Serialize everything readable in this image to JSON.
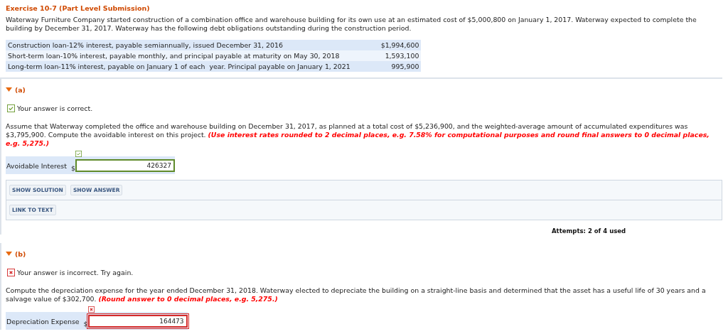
{
  "exercise": {
    "title": "Exercise 10-7 (Part Level Submission)",
    "intro": "Waterway Furniture Company started construction of a combination office and warehouse building for its own use at an estimated cost of $5,000,800 on January 1, 2017. Waterway expected to complete the building by December 31, 2017. Waterway has the following debt obligations outstanding during the construction period.",
    "loans": [
      {
        "description": "Construction loan-12% interest, payable semiannually, issued December 31, 2016",
        "amount": "$1,994,600"
      },
      {
        "description": "Short-term loan-10% interest, payable monthly, and principal payable at maturity on May 30, 2018",
        "amount": "1,593,100"
      },
      {
        "description": "Long-term loan-11% interest, payable on January 1 of each  year. Principal payable on January 1, 2021",
        "amount": "995,900"
      }
    ]
  },
  "parts": [
    {
      "label": "(a)",
      "expanded": true,
      "correct": true,
      "result": "Your answer is correct.",
      "question": "Assume that Waterway completed the office and warehouse building on December 31, 2017, as planned at a total cost of $5,236,900, and the weighted-average amount of accumulated expenditures was $3,795,900. Compute the avoidable interest on this project.",
      "instruction": "(Use interest rates rounded to 2 decimal places, e.g. 7.58% for computational purposes and round final answers to 0 decimal places, e.g. 5,275.)",
      "answer": {
        "label": "Avoidable Interest",
        "unit": "$",
        "value": "426327"
      },
      "buttons": [
        "SHOW SOLUTION",
        "SHOW ANSWER"
      ],
      "links": [
        "LINK TO TEXT"
      ],
      "attempts": "Attempts: 2 of 4 used"
    },
    {
      "label": "(b)",
      "expanded": true,
      "correct": false,
      "result": "Your answer is incorrect.  Try again.",
      "question": "Compute the depreciation expense for the year ended December 31, 2018. Waterway elected to depreciate the building on a straight-line basis and determined that the asset has a useful life of 30 years and a salvage value of $302,700.",
      "instruction": "(Round answer to 0 decimal places, e.g. 5,275.)",
      "answer": {
        "label": "Depreciation Expense",
        "unit": "$",
        "value": "164473"
      }
    }
  ]
}
